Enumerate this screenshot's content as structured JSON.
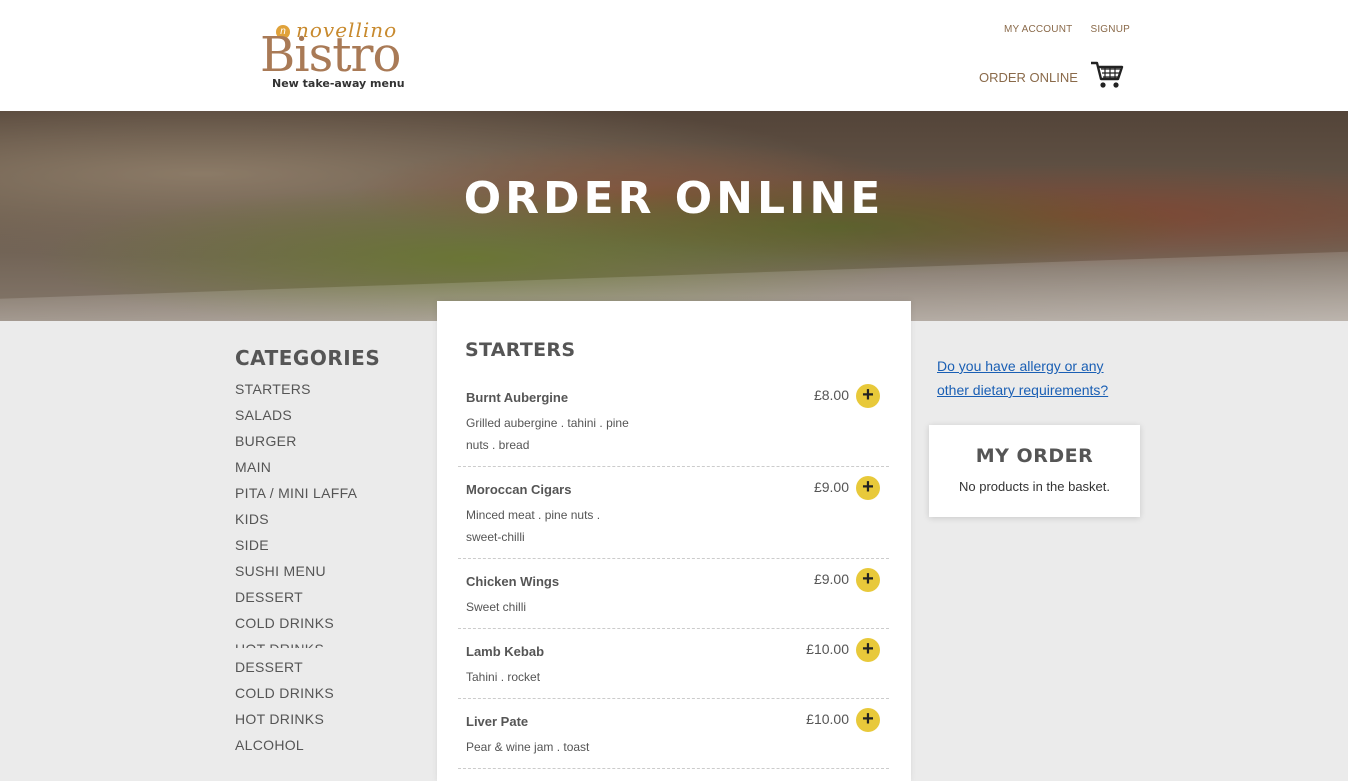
{
  "header": {
    "logo": {
      "script": "novellino",
      "badge": "n",
      "name": "Bistro",
      "tagline": "New take-away menu"
    },
    "top_links": [
      "MY ACCOUNT",
      "SIGNUP"
    ],
    "order_online": "ORDER ONLINE"
  },
  "hero": {
    "title": "ORDER ONLINE"
  },
  "categories": {
    "title": "CATEGORIES",
    "items": [
      "STARTERS",
      "SALADS",
      "BURGER",
      "MAIN",
      "PITA / MINI LAFFA",
      "KIDS",
      "SIDE",
      "SUSHI MENU",
      "DESSERT",
      "COLD DRINKS",
      "HOT DRINKS"
    ],
    "overflow_items": [
      "DESSERT",
      "COLD DRINKS",
      "HOT DRINKS",
      "ALCOHOL"
    ]
  },
  "menu": {
    "section_title": "STARTERS",
    "add_symbol": "+",
    "items": [
      {
        "name": "Burnt Aubergine",
        "desc": "Grilled aubergine . tahini . pine nuts . bread",
        "price": "£8.00"
      },
      {
        "name": "Moroccan Cigars",
        "desc": "Minced meat . pine nuts . sweet-chilli",
        "price": "£9.00"
      },
      {
        "name": "Chicken Wings",
        "desc": "Sweet chilli",
        "price": "£9.00"
      },
      {
        "name": "Lamb Kebab",
        "desc": "Tahini . rocket",
        "price": "£10.00"
      },
      {
        "name": "Liver Pate",
        "desc": "Pear & wine jam . toast",
        "price": "£10.00"
      }
    ]
  },
  "sidebar": {
    "allergy_link": "Do you have allergy or any other dietary requirements?",
    "my_order_title": "MY ORDER",
    "my_order_empty": "No products in the basket."
  },
  "colors": {
    "accent_yellow": "#e8c93a",
    "brand_brown": "#8a6a4a",
    "link_blue": "#1a5fb4"
  }
}
